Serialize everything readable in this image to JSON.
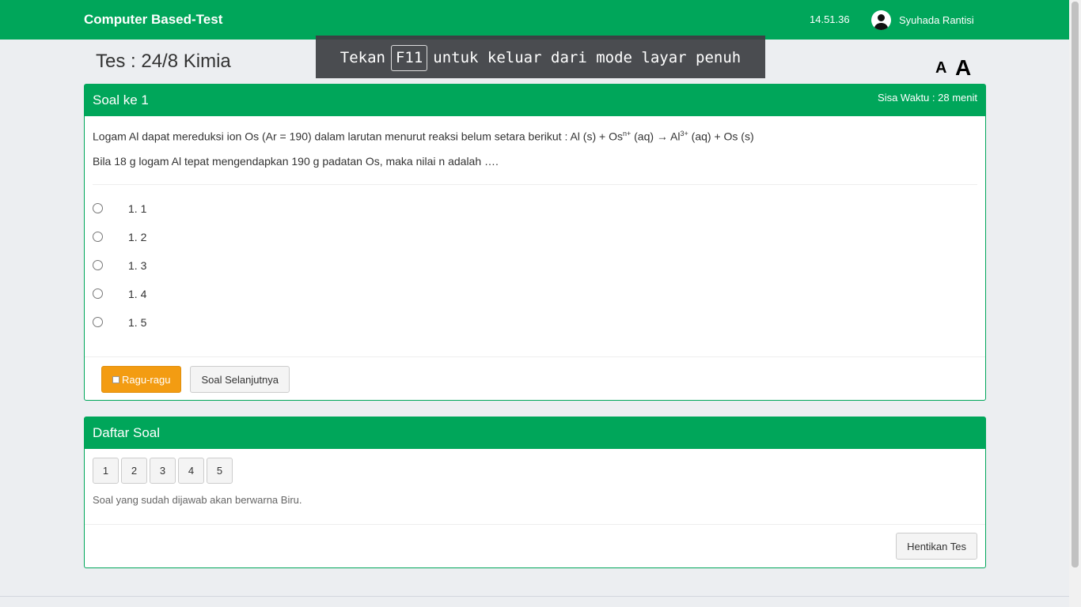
{
  "header": {
    "brand": "Computer Based-Test",
    "clock": "14.51.36",
    "user_name": "Syuhada Rantisi",
    "avatar_icon": "user-avatar-icon"
  },
  "fullscreen_notice": {
    "before": "Tekan",
    "key": "F11",
    "after": "untuk keluar dari mode layar penuh"
  },
  "test_title": "Tes : 24/8 Kimia",
  "font_controls": {
    "small": "A",
    "large": "A"
  },
  "question_panel": {
    "title": "Soal ke 1",
    "timer": "Sisa Waktu : 28 menit",
    "line1": {
      "a": "Logam Al dapat mereduksi ion Os (Ar = 190) dalam larutan menurut reaksi belum setara berikut : Al (s) + Os",
      "sup1": "n+",
      "b": " (aq) → Al",
      "sup2": "3+",
      "c": " (aq) + Os (s)"
    },
    "line2": "Bila 18 g logam Al tepat mengendapkan 190 g padatan Os, maka nilai n adalah ….",
    "options": [
      "1. 1",
      "1. 2",
      "1. 3",
      "1. 4",
      "1. 5"
    ],
    "doubt_button": "Ragu-ragu",
    "next_button": "Soal Selanjutnya"
  },
  "list_panel": {
    "title": "Daftar Soal",
    "numbers": [
      "1",
      "2",
      "3",
      "4",
      "5"
    ],
    "hint": "Soal yang sudah dijawab akan berwarna Biru.",
    "stop_button": "Hentikan Tes"
  },
  "colors": {
    "primary": "#00a65a",
    "warning": "#f39c12"
  }
}
